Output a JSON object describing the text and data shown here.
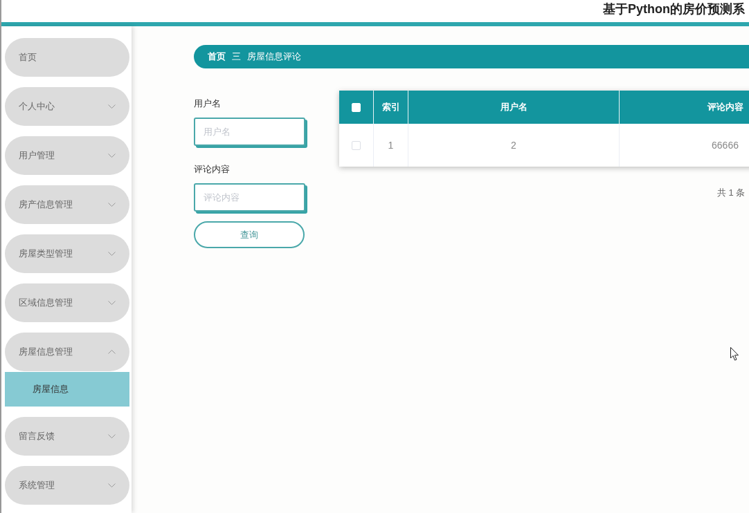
{
  "header": {
    "title": "基于Python的房价预测系"
  },
  "sidebar": {
    "items": [
      {
        "label": "首页",
        "kind": "link"
      },
      {
        "label": "个人中心",
        "kind": "submenu",
        "expanded": false
      },
      {
        "label": "用户管理",
        "kind": "submenu",
        "expanded": false
      },
      {
        "label": "房产信息管理",
        "kind": "submenu",
        "expanded": false
      },
      {
        "label": "房屋类型管理",
        "kind": "submenu",
        "expanded": false
      },
      {
        "label": "区域信息管理",
        "kind": "submenu",
        "expanded": false
      },
      {
        "label": "房屋信息管理",
        "kind": "submenu",
        "expanded": true,
        "children": [
          {
            "label": "房屋信息",
            "selected": true
          }
        ]
      },
      {
        "label": "留言反馈",
        "kind": "submenu",
        "expanded": false
      },
      {
        "label": "系统管理",
        "kind": "submenu",
        "expanded": false
      }
    ]
  },
  "breadcrumb": {
    "items": [
      {
        "label": "首页"
      },
      {
        "label": "房屋信息评论"
      }
    ],
    "separator": "三"
  },
  "search_form": {
    "fields": [
      {
        "label": "用户名",
        "placeholder": "用户名"
      },
      {
        "label": "评论内容",
        "placeholder": "评论内容"
      }
    ],
    "button": "查询"
  },
  "table": {
    "select_all_checked": false,
    "columns": [
      "索引",
      "用户名",
      "评论内容"
    ],
    "rows": [
      {
        "selected": false,
        "cells": [
          "1",
          "2",
          "66666"
        ]
      }
    ]
  },
  "pagination": {
    "total": "共 1 条"
  }
}
